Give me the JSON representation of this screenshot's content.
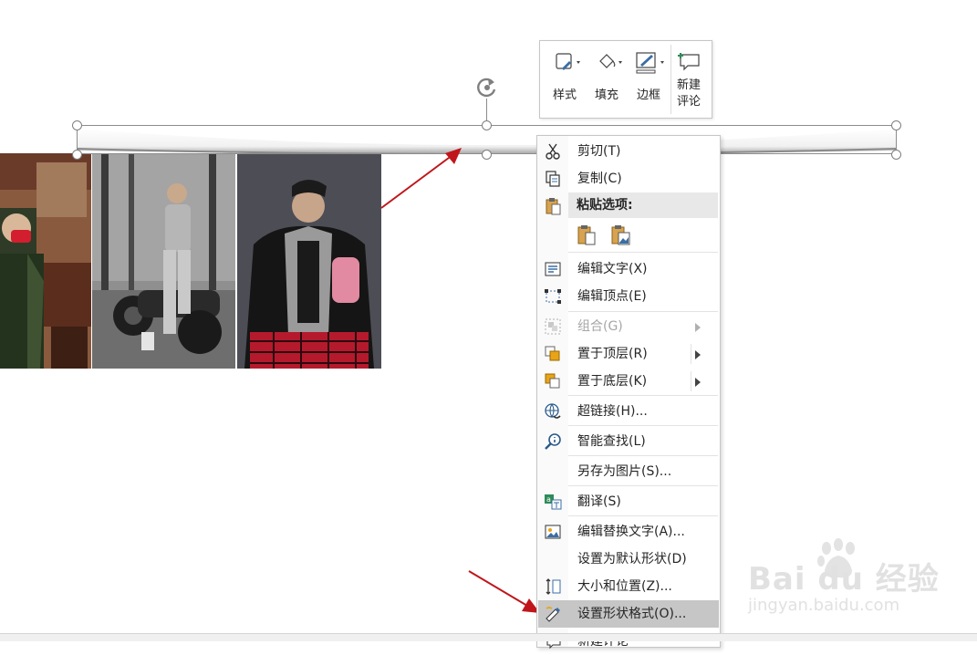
{
  "mini_toolbar": {
    "style_label": "样式",
    "fill_label": "填充",
    "border_label": "边框",
    "comment_label_line1": "新建",
    "comment_label_line2": "评论"
  },
  "context_menu": {
    "cut": "剪切(T)",
    "copy": "复制(C)",
    "paste_options": "粘贴选项:",
    "edit_text": "编辑文字(X)",
    "edit_points": "编辑顶点(E)",
    "group": "组合(G)",
    "bring_to_front": "置于顶层(R)",
    "send_to_back": "置于底层(K)",
    "hyperlink": "超链接(H)...",
    "smart_lookup": "智能查找(L)",
    "save_as_picture": "另存为图片(S)...",
    "translate": "翻译(S)",
    "edit_alt_text": "编辑替换文字(A)...",
    "set_default_shape": "设置为默认形状(D)",
    "size_and_position": "大小和位置(Z)...",
    "format_shape": "设置形状格式(O)...",
    "new_comment": "新建评论"
  },
  "watermark": {
    "brand": "Bai du 经验",
    "url": "jingyan.baidu.com"
  },
  "colors": {
    "arrow": "#c0161b",
    "menu_highlight": "#c6c6c6",
    "paste_header_bg": "#e8e8e8"
  }
}
